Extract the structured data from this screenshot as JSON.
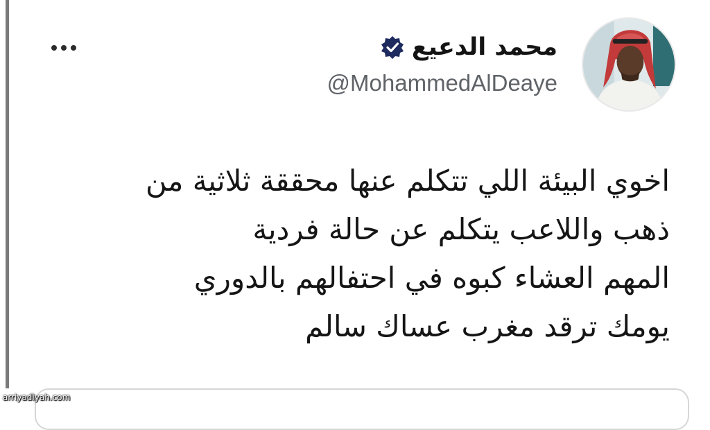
{
  "author": {
    "display_name": "محمد الدعيع",
    "handle": "@MohammedAlDeaye",
    "verified": true,
    "avatar_icon": "profile-photo"
  },
  "actions": {
    "more_icon": "more-horizontal-icon"
  },
  "tweet": {
    "lines": [
      "اخوي البيئة اللي تتكلم عنها محققة ثلاثية من",
      "ذهب واللاعب يتكلم عن حالة فردية",
      "المهم العشاء كبوه في احتفالهم بالدوري",
      "يومك ترقد مغرب عساك سالم"
    ]
  },
  "watermark": "arriyadiyah.com",
  "colors": {
    "text": "#151515",
    "muted": "#5f6368",
    "verified_badge": "#1d2b5e",
    "border": "#d6d6d6"
  }
}
